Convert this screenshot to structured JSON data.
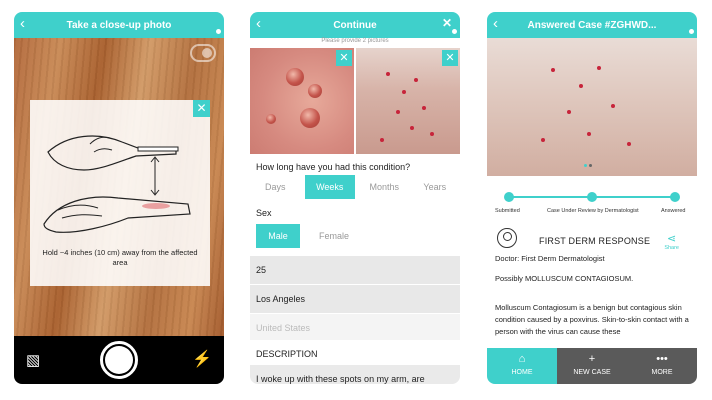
{
  "colors": {
    "accent": "#3fd0cb",
    "nav_inactive": "#5a5a5a"
  },
  "screen1": {
    "title": "Take a close-up photo",
    "back_icon": "chevron-left-icon",
    "close_icon": "close-icon",
    "hint": "Hold ~4 inches (10 cm) away from the affected area",
    "icons": {
      "gallery": "gallery-icon",
      "shutter": "shutter-button",
      "flash": "flash-icon",
      "toggle": "toggle-icon"
    }
  },
  "screen2": {
    "title": "Continue",
    "subtitle": "Please provide 2 pictures",
    "question": "How long have you had this condition?",
    "durations": [
      "Days",
      "Weeks",
      "Months",
      "Years"
    ],
    "selected_duration": "Weeks",
    "sex_label": "Sex",
    "sexes": [
      "Male",
      "Female"
    ],
    "selected_sex": "Male",
    "age": "25",
    "city": "Los Angeles",
    "country_placeholder": "United States",
    "description_label": "DESCRIPTION",
    "description_text": "I woke up with these spots on my arm, are"
  },
  "screen3": {
    "title": "Answered Case #ZGHWD...",
    "timeline": [
      "Submitted",
      "Case Under Review by Dermatologist",
      "Answered"
    ],
    "response_title": "FIRST DERM RESPONSE",
    "share_label": "Share",
    "doctor": "Doctor: First Derm Dermatologist",
    "diagnosis": "Possibly MOLLUSCUM CONTAGIOSUM.",
    "paragraph": "Molluscum Contagiosum is a benign but contagious skin condition caused by a poxvirus. Skin-to-skin contact with a person with the virus can cause these",
    "nav": [
      "HOME",
      "NEW CASE",
      "MORE"
    ],
    "nav_icons": [
      "home-icon",
      "plus-icon",
      "more-icon"
    ]
  }
}
